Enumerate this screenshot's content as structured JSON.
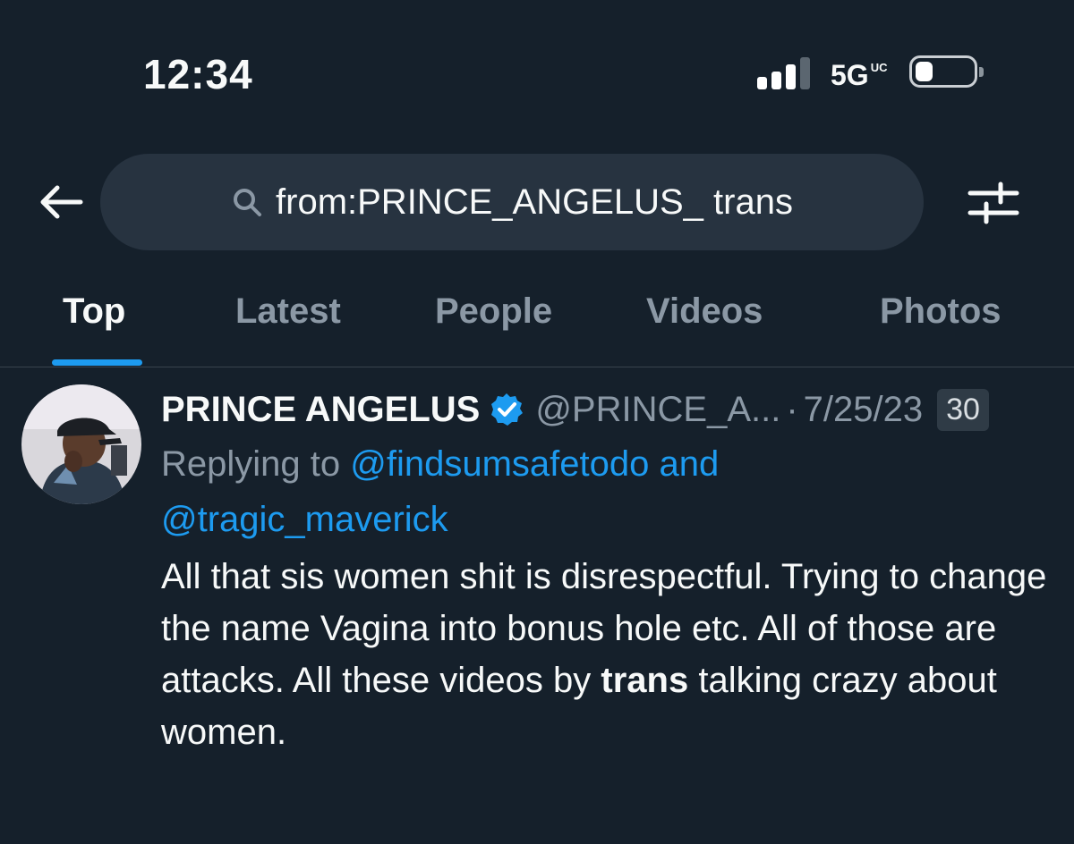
{
  "status_bar": {
    "time": "12:34",
    "network": "5G",
    "network_suffix": "UC",
    "battery_level": 0.3
  },
  "search": {
    "query": "from:PRINCE_ANGELUS_ trans"
  },
  "tabs": [
    {
      "label": "Top",
      "active": true
    },
    {
      "label": "Latest",
      "active": false
    },
    {
      "label": "People",
      "active": false
    },
    {
      "label": "Videos",
      "active": false
    },
    {
      "label": "Photos",
      "active": false
    }
  ],
  "tweet": {
    "author_name": "PRINCE ANGELUS",
    "handle": "@PRINCE_A...",
    "separator": "·",
    "date": "7/25/23",
    "badge": "30",
    "replying_prefix": "Replying to",
    "mention_1": "@findsumsafetodo",
    "joiner": "and",
    "mention_2": "@tragic_maverick",
    "body_part_1": "All that sis women shit is disrespectful. Trying to change the name Vagina into bonus hole etc. All of those are attacks. All these videos by",
    "body_bold": "trans",
    "body_part_2": "talking crazy about women."
  },
  "colors": {
    "background": "#15202b",
    "accent": "#1d9bf0",
    "muted": "#8b98a5",
    "search_bg": "#273340"
  },
  "icons": [
    "back-arrow-icon",
    "search-icon",
    "filter-sliders-icon",
    "verified-badge-icon",
    "signal-icon",
    "battery-icon"
  ]
}
